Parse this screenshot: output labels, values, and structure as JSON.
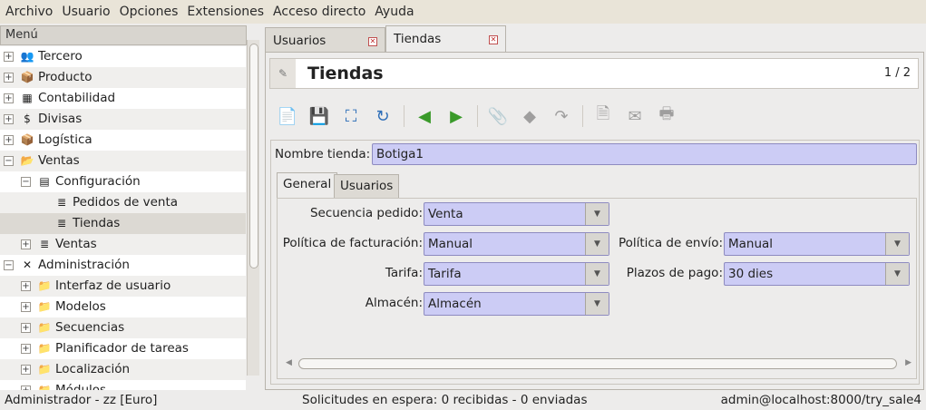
{
  "menubar": [
    "Archivo",
    "Usuario",
    "Opciones",
    "Extensiones",
    "Acceso directo",
    "Ayuda"
  ],
  "sidebar": {
    "header": "Menú",
    "items": [
      {
        "label": "Tercero",
        "exp": "+",
        "icon": "people-icon",
        "glyph": "👥",
        "level": 0
      },
      {
        "label": "Producto",
        "exp": "+",
        "icon": "product-icon",
        "glyph": "📦",
        "level": 0
      },
      {
        "label": "Contabilidad",
        "exp": "+",
        "icon": "calculator-icon",
        "glyph": "▦",
        "level": 0
      },
      {
        "label": "Divisas",
        "exp": "+",
        "icon": "currency-icon",
        "glyph": "$",
        "level": 0
      },
      {
        "label": "Logística",
        "exp": "+",
        "icon": "logistics-icon",
        "glyph": "📦",
        "level": 0
      },
      {
        "label": "Ventas",
        "exp": "−",
        "icon": "folder-open-icon",
        "glyph": "📂",
        "level": 0
      },
      {
        "label": "Configuración",
        "exp": "−",
        "icon": "config-icon",
        "glyph": "▤",
        "level": 1
      },
      {
        "label": "Pedidos de venta",
        "exp": "",
        "icon": "list-icon",
        "glyph": "≣",
        "level": 2
      },
      {
        "label": "Tiendas",
        "exp": "",
        "icon": "list-icon",
        "glyph": "≣",
        "level": 2,
        "selected": true
      },
      {
        "label": "Ventas",
        "exp": "+",
        "icon": "list-icon",
        "glyph": "≣",
        "level": 1
      },
      {
        "label": "Administración",
        "exp": "−",
        "icon": "tools-icon",
        "glyph": "✕",
        "level": 0
      },
      {
        "label": "Interfaz de usuario",
        "exp": "+",
        "icon": "folder-icon",
        "glyph": "📁",
        "level": 1
      },
      {
        "label": "Modelos",
        "exp": "+",
        "icon": "folder-icon",
        "glyph": "📁",
        "level": 1
      },
      {
        "label": "Secuencias",
        "exp": "+",
        "icon": "folder-icon",
        "glyph": "📁",
        "level": 1
      },
      {
        "label": "Planificador de tareas",
        "exp": "+",
        "icon": "folder-icon",
        "glyph": "📁",
        "level": 1
      },
      {
        "label": "Localización",
        "exp": "+",
        "icon": "folder-icon",
        "glyph": "📁",
        "level": 1
      },
      {
        "label": "Módulos",
        "exp": "+",
        "icon": "folder-icon",
        "glyph": "📁",
        "level": 1
      }
    ]
  },
  "tabs": [
    {
      "label": "Usuarios",
      "active": false
    },
    {
      "label": "Tiendas",
      "active": true
    }
  ],
  "form": {
    "title": "Tiendas",
    "pager": "1 / 2",
    "toolbar": [
      {
        "name": "new-icon",
        "glyph": "📄",
        "enabled": true
      },
      {
        "name": "save-icon",
        "glyph": "💾",
        "enabled": true
      },
      {
        "name": "switch-view-icon",
        "glyph": "⛶",
        "enabled": true
      },
      {
        "name": "reload-icon",
        "glyph": "↻",
        "enabled": true
      },
      {
        "name": "previous-icon",
        "glyph": "◀",
        "enabled": true
      },
      {
        "name": "next-icon",
        "glyph": "▶",
        "enabled": true
      },
      {
        "name": "attachment-icon",
        "glyph": "📎",
        "enabled": false
      },
      {
        "name": "action-icon",
        "glyph": "◆",
        "enabled": false
      },
      {
        "name": "relate-icon",
        "glyph": "↷",
        "enabled": false
      },
      {
        "name": "report-icon",
        "glyph": "🗎",
        "enabled": false
      },
      {
        "name": "email-icon",
        "glyph": "✉",
        "enabled": false
      },
      {
        "name": "print-icon",
        "glyph": "🖶",
        "enabled": false
      }
    ],
    "name_label": "Nombre tienda:",
    "name_value": "Botiga1",
    "subtabs": [
      "General",
      "Usuarios"
    ],
    "fields": {
      "sequence_label": "Secuencia pedido:",
      "sequence_value": "Venta",
      "invoice_label": "Política de facturación:",
      "invoice_value": "Manual",
      "shipment_label": "Política de envío:",
      "shipment_value": "Manual",
      "tariff_label": "Tarifa:",
      "tariff_value": "Tarifa",
      "payment_label": "Plazos de pago:",
      "payment_value": "30 dies",
      "warehouse_label": "Almacén:",
      "warehouse_value": "Almacén"
    }
  },
  "status": {
    "left": "Administrador - zz [Euro]",
    "center": "Solicitudes en espera: 0 recibidas - 0 enviadas",
    "right": "admin@localhost:8000/try_sale4"
  },
  "colors": {
    "field_bg": "#ccccf5",
    "accent_green": "#3a9a2a",
    "accent_blue": "#2f6fb8"
  }
}
